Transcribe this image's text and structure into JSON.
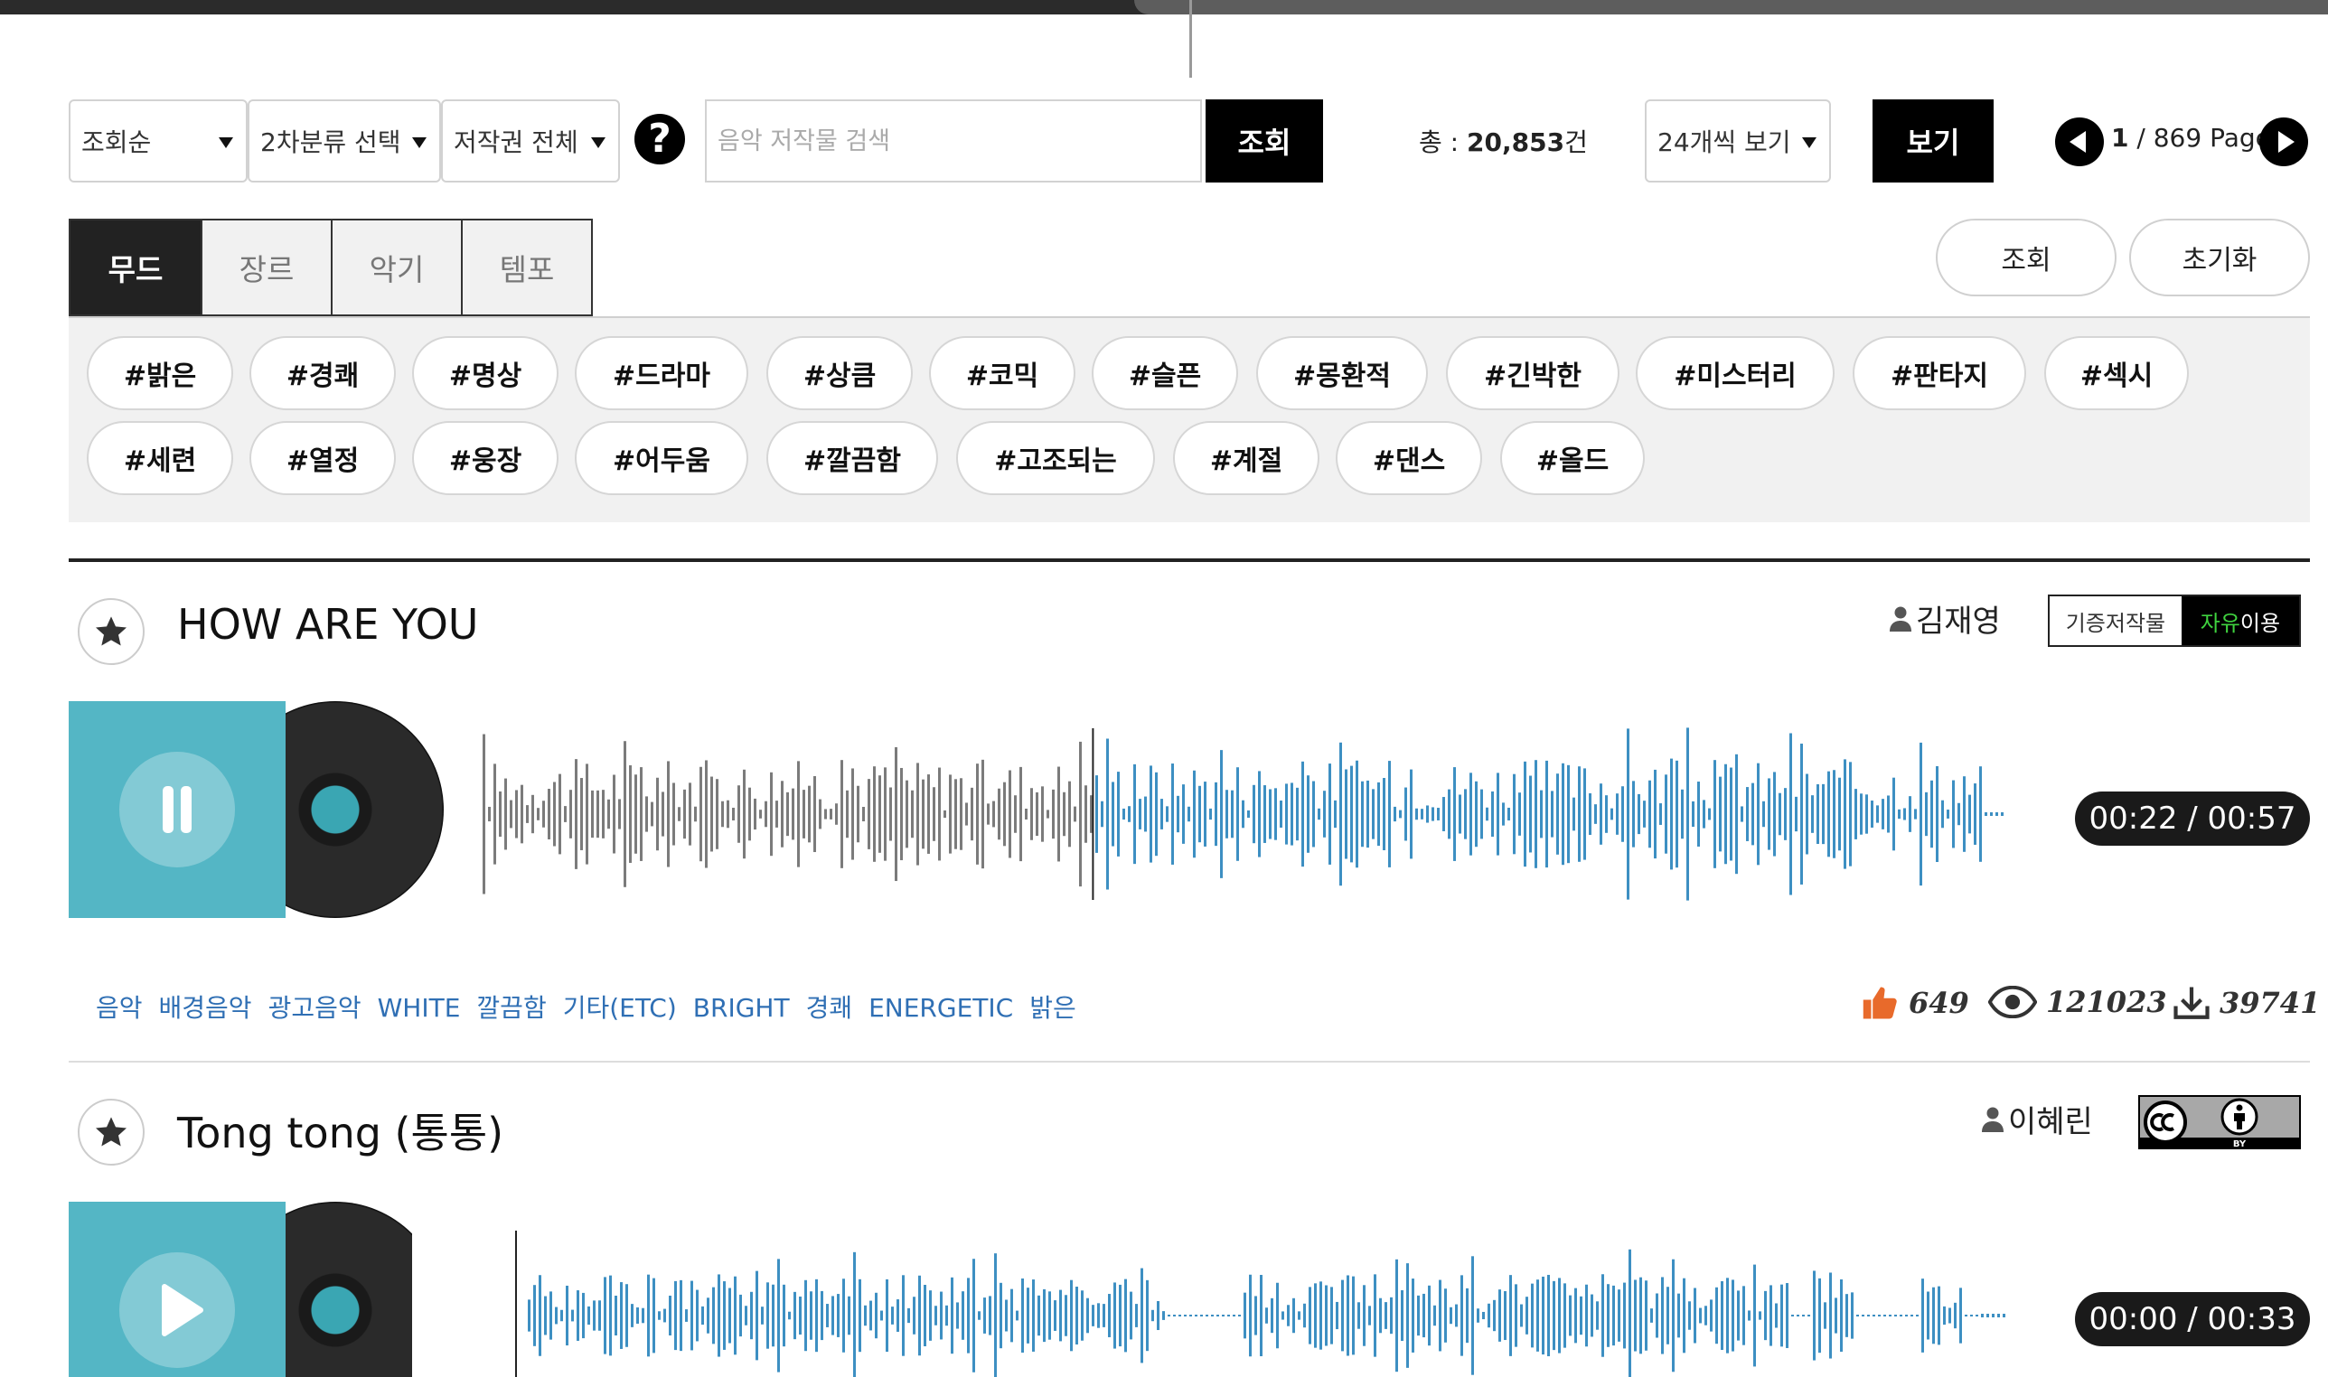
{
  "filters": {
    "sort": "조회순",
    "category2": "2차분류 선택",
    "copyright": "저작권 전체",
    "search_placeholder": "음악 저작물 검색",
    "search_button": "조회",
    "total_label": "총 : ",
    "total_value": "20,853",
    "total_unit": "건",
    "per_page": "24개씩 보기",
    "view_button": "보기",
    "current_page": "1",
    "page_suffix": " / 869 Page"
  },
  "tabs": [
    "무드",
    "장르",
    "악기",
    "템포"
  ],
  "tag_actions": {
    "apply": "조회",
    "reset": "초기화"
  },
  "tags_row1": [
    "#밝은",
    "#경쾌",
    "#명상",
    "#드라마",
    "#상큼",
    "#코믹",
    "#슬픈",
    "#몽환적",
    "#긴박한",
    "#미스터리",
    "#판타지",
    "#섹시"
  ],
  "tags_row2": [
    "#세련",
    "#열정",
    "#웅장",
    "#어두움",
    "#깔끔함",
    "#고조되는",
    "#계절",
    "#댄스",
    "#올드"
  ],
  "tracks": [
    {
      "title": "HOW ARE YOU",
      "artist": "김재영",
      "license_left": "기증저작물",
      "license_right_g": "자유",
      "license_right": "이용",
      "time": "00:22 / 00:57",
      "progress": 0.4,
      "playing": true,
      "keywords": [
        "음악",
        "배경음악",
        "광고음악",
        "WHITE",
        "깔끔함",
        "기타(ETC)",
        "BRIGHT",
        "경쾌",
        "ENERGETIC",
        "밝은"
      ],
      "likes": "649",
      "views": "121023",
      "downloads": "39741"
    },
    {
      "title": "Tong tong (통통)",
      "artist": "이혜린",
      "license_badge": "cc-by",
      "time": "00:00 / 00:33",
      "progress": 0,
      "playing": false
    }
  ],
  "colors": {
    "wave_played": "#7b7b7b",
    "wave_rest": "#3d8fc2",
    "cover": "#54b6c5",
    "keyword": "#2f6fb4",
    "like": "#e86a2b"
  }
}
